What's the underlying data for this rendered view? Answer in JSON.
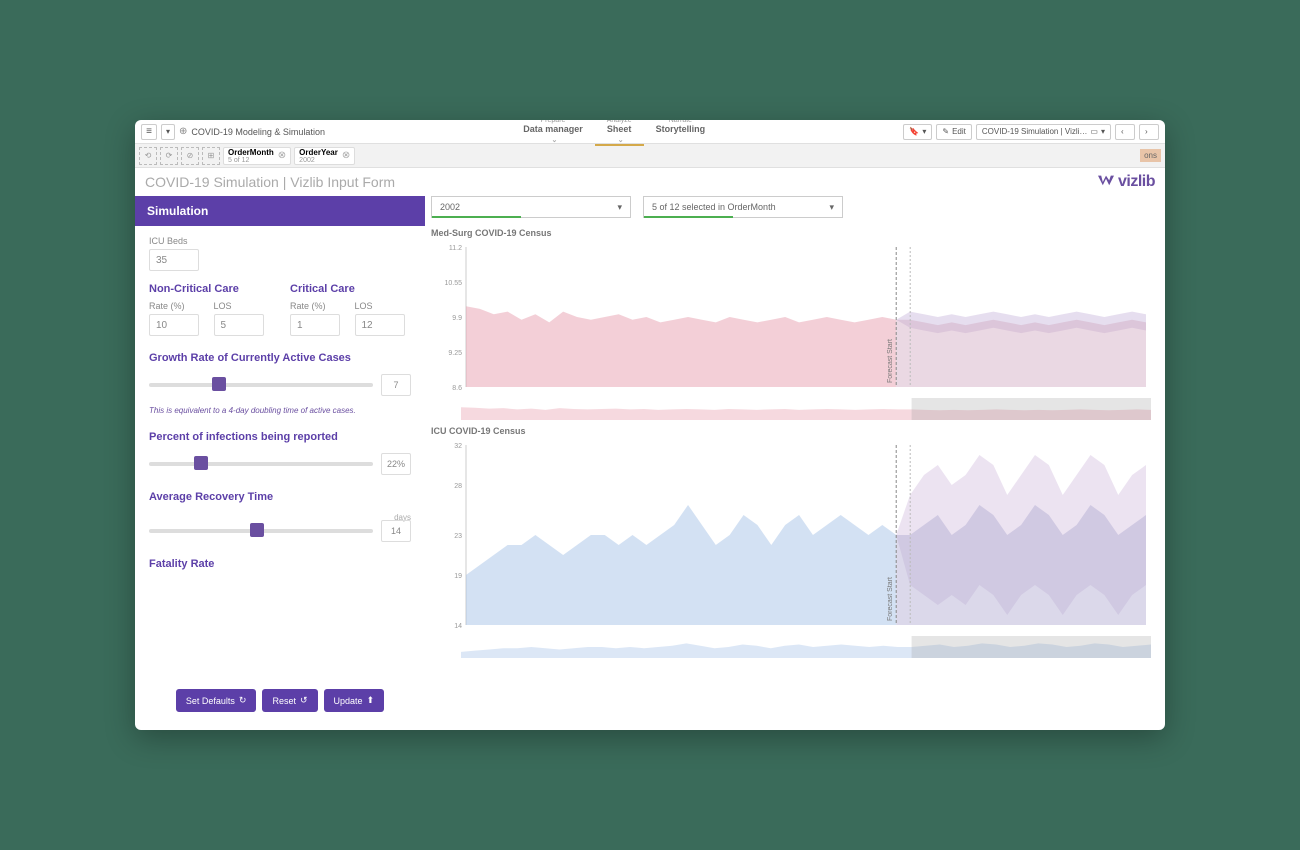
{
  "app_title": "COVID-19 Modeling & Simulation",
  "nav": {
    "prepare": {
      "sub": "Prepare",
      "main": "Data manager"
    },
    "analyze": {
      "sub": "Analyze",
      "main": "Sheet"
    },
    "narrate": {
      "sub": "Narrate",
      "main": "Storytelling"
    }
  },
  "toolbar": {
    "edit": "Edit",
    "sheet_name": "COVID-19 Simulation | Vizli…"
  },
  "filters": {
    "order_month": {
      "name": "OrderMonth",
      "val": "5 of 12"
    },
    "order_year": {
      "name": "OrderYear",
      "val": "2002"
    },
    "end_tag": "ons"
  },
  "page_title": "COVID-19 Simulation | Vizlib Input Form",
  "logo_text": "vizlib",
  "sidebar": {
    "header": "Simulation",
    "icu_beds": {
      "label": "ICU Beds",
      "value": "35"
    },
    "non_critical": {
      "title": "Non-Critical Care",
      "rate_label": "Rate (%)",
      "rate": "10",
      "los_label": "LOS",
      "los": "5"
    },
    "critical": {
      "title": "Critical Care",
      "rate_label": "Rate (%)",
      "rate": "1",
      "los_label": "LOS",
      "los": "12"
    },
    "growth": {
      "title": "Growth Rate of Currently Active Cases",
      "value": "7",
      "note": "This is equivalent to a 4-day doubling time of active cases."
    },
    "reported": {
      "title": "Percent of infections being reported",
      "value": "22%"
    },
    "recovery": {
      "title": "Average Recovery Time",
      "unit": "days",
      "value": "14"
    },
    "fatality": {
      "title": "Fatality Rate"
    },
    "buttons": {
      "defaults": "Set Defaults",
      "reset": "Reset",
      "update": "Update"
    }
  },
  "dropdowns": {
    "year": "2002",
    "month": "5 of 12 selected in OrderMonth"
  },
  "charts": {
    "med_surg_title": "Med-Surg COVID-19 Census",
    "icu_title": "ICU COVID-19 Census",
    "forecast_label": "Forecast Start"
  },
  "chart_data": [
    {
      "type": "area",
      "title": "Med-Surg COVID-19 Census",
      "ylabel": "",
      "ylim": [
        8.6,
        11.2
      ],
      "yticks": [
        8.6,
        9.25,
        9.9,
        10.55,
        11.2
      ],
      "forecast_start_index": 32,
      "series": [
        {
          "name": "actual",
          "values": [
            10.1,
            10.05,
            9.95,
            10.0,
            9.85,
            9.95,
            9.8,
            10.0,
            9.9,
            9.85,
            9.9,
            9.95,
            9.85,
            9.9,
            9.8,
            9.85,
            9.9,
            9.85,
            9.8,
            9.9,
            9.85,
            9.8,
            9.85,
            9.9,
            9.8,
            9.85,
            9.9,
            9.85,
            9.8,
            9.85,
            9.9,
            9.85
          ]
        },
        {
          "name": "forecast_mid",
          "values": [
            9.85,
            9.8,
            9.75,
            9.8,
            9.75,
            9.8,
            9.85,
            9.8,
            9.75,
            9.8,
            9.75,
            9.8,
            9.85,
            9.8,
            9.75,
            9.8,
            9.85,
            9.8
          ]
        },
        {
          "name": "forecast_upper",
          "values": [
            10.0,
            9.95,
            9.9,
            9.95,
            9.9,
            9.95,
            10.0,
            9.95,
            9.9,
            9.95,
            9.9,
            9.95,
            10.0,
            9.95,
            9.9,
            9.95,
            10.0,
            9.95
          ]
        },
        {
          "name": "forecast_lower",
          "values": [
            9.7,
            9.65,
            9.6,
            9.65,
            9.6,
            9.65,
            9.7,
            9.65,
            9.6,
            9.65,
            9.6,
            9.65,
            9.7,
            9.65,
            9.6,
            9.65,
            9.7,
            9.65
          ]
        }
      ]
    },
    {
      "type": "area",
      "title": "ICU COVID-19 Census",
      "ylabel": "",
      "ylim": [
        14,
        32
      ],
      "yticks": [
        14,
        19,
        23,
        28,
        32
      ],
      "forecast_start_index": 32,
      "series": [
        {
          "name": "actual",
          "values": [
            19,
            20,
            21,
            22,
            22,
            23,
            22,
            21,
            22,
            23,
            23,
            22,
            23,
            22,
            23,
            24,
            26,
            24,
            22,
            23,
            25,
            24,
            22,
            24,
            25,
            23,
            24,
            25,
            24,
            23,
            24,
            23
          ]
        },
        {
          "name": "forecast_mid",
          "values": [
            23,
            24,
            25,
            23,
            24,
            26,
            25,
            23,
            24,
            26,
            25,
            23,
            24,
            26,
            25,
            23,
            24,
            25
          ]
        },
        {
          "name": "forecast_upper",
          "values": [
            27,
            29,
            30,
            28,
            29,
            31,
            30,
            27,
            29,
            31,
            30,
            27,
            29,
            31,
            30,
            27,
            29,
            30
          ]
        },
        {
          "name": "forecast_lower",
          "values": [
            18,
            17,
            16,
            17,
            16,
            18,
            17,
            15,
            17,
            18,
            17,
            15,
            17,
            18,
            17,
            15,
            17,
            18
          ]
        }
      ]
    }
  ]
}
